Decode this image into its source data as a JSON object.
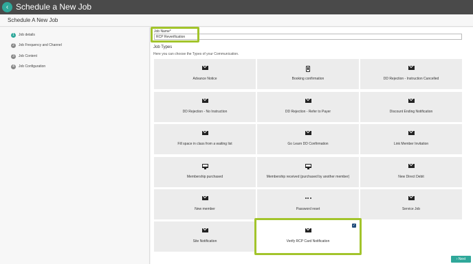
{
  "header": {
    "title": "Schedule a New Job",
    "back_icon": "chevron-left-icon"
  },
  "page": {
    "title": "Schedule A New Job"
  },
  "steps": [
    {
      "num": "1",
      "label": "Job details",
      "active": true
    },
    {
      "num": "2",
      "label": "Job Frequency and Channel",
      "active": false
    },
    {
      "num": "3",
      "label": "Job Content",
      "active": false
    },
    {
      "num": "4",
      "label": "Job Configuration",
      "active": false
    }
  ],
  "form": {
    "name_label": "Job Name*",
    "name_value": "RCP Reverification"
  },
  "job_types": {
    "title": "Job Types",
    "description": "Here you can choose the Types of your Communication.",
    "cards": [
      {
        "label": "Advance Notice",
        "icon": "mail-icon",
        "selected": false
      },
      {
        "label": "Booking confirmation",
        "icon": "phone-icon",
        "selected": false
      },
      {
        "label": "DD Rejection - Instruction Cancelled",
        "icon": "mail-icon",
        "selected": false
      },
      {
        "label": "DD Rejection - No Instruction",
        "icon": "mail-icon",
        "selected": false
      },
      {
        "label": "DD Rejection - Refer to Payer",
        "icon": "mail-icon",
        "selected": false
      },
      {
        "label": "Discount Ending Notification",
        "icon": "mail-icon",
        "selected": false
      },
      {
        "label": "Fill space in class from a waiting list",
        "icon": "mail-icon",
        "selected": false
      },
      {
        "label": "Go Learn DD Confirmation",
        "icon": "mail-icon",
        "selected": false
      },
      {
        "label": "Link Member Invitation",
        "icon": "mail-icon",
        "selected": false
      },
      {
        "label": "Membership purchased",
        "icon": "monitor-icon",
        "selected": false
      },
      {
        "label": "Membership received (purchased by another member)",
        "icon": "monitor-icon",
        "selected": false
      },
      {
        "label": "New Direct Debit",
        "icon": "mail-icon",
        "selected": false
      },
      {
        "label": "New member",
        "icon": "mail-icon",
        "selected": false
      },
      {
        "label": "Password reset",
        "icon": "dots-icon",
        "selected": false
      },
      {
        "label": "Service Job",
        "icon": "mail-icon",
        "selected": false
      },
      {
        "label": "Site Notification",
        "icon": "mail-icon",
        "selected": false
      },
      {
        "label": "Verify RCP Card Notification",
        "icon": "mail-icon",
        "selected": true
      }
    ]
  },
  "footer": {
    "next_label": "Next",
    "next_icon": "chevron-right-icon"
  },
  "colors": {
    "accent": "#2fa89a",
    "highlight": "#a2c42b",
    "header_bg": "#4a4a4a",
    "checkbox": "#1f4b7a"
  }
}
